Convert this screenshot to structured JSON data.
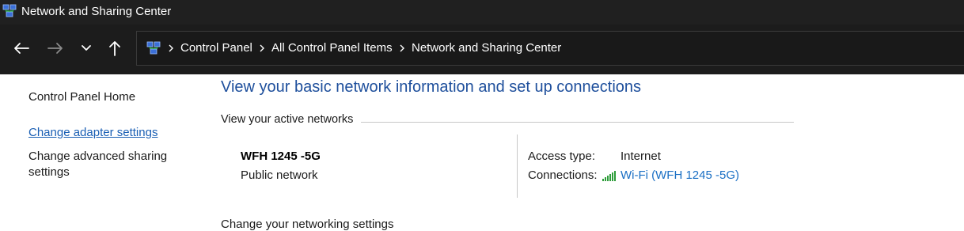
{
  "window": {
    "title": "Network and Sharing Center",
    "app_icon": "network-sharing-icon"
  },
  "navigation": {
    "back_icon": "back-arrow-icon",
    "forward_icon": "forward-arrow-icon",
    "recent_icon": "chevron-down-icon",
    "up_icon": "up-arrow-icon"
  },
  "address_bar": {
    "icon": "control-panel-icon",
    "separator_icon": "chevron-right-icon",
    "breadcrumbs": [
      "Control Panel",
      "All Control Panel Items",
      "Network and Sharing Center"
    ]
  },
  "left_pane": {
    "home": "Control Panel Home",
    "adapter_settings": "Change adapter settings",
    "advanced_sharing_line1": "Change advanced sharing",
    "advanced_sharing_line2": "settings"
  },
  "main": {
    "heading": "View your basic network information and set up connections",
    "active_networks_label": "View your active networks",
    "network": {
      "name": "WFH 1245 -5G",
      "category": "Public network",
      "access_type_label": "Access type:",
      "access_type_value": "Internet",
      "connections_label": "Connections:",
      "connection_icon": "wifi-signal-icon",
      "connection_link": "Wi-Fi (WFH 1245 -5G)"
    },
    "change_settings_label": "Change your networking settings"
  },
  "colors": {
    "titlebar_bg": "#202020",
    "navbar_bg": "#1c1c1c",
    "heading": "#1e4f9c",
    "link": "#1a6fc4",
    "signal_green": "#2e9d3a"
  }
}
